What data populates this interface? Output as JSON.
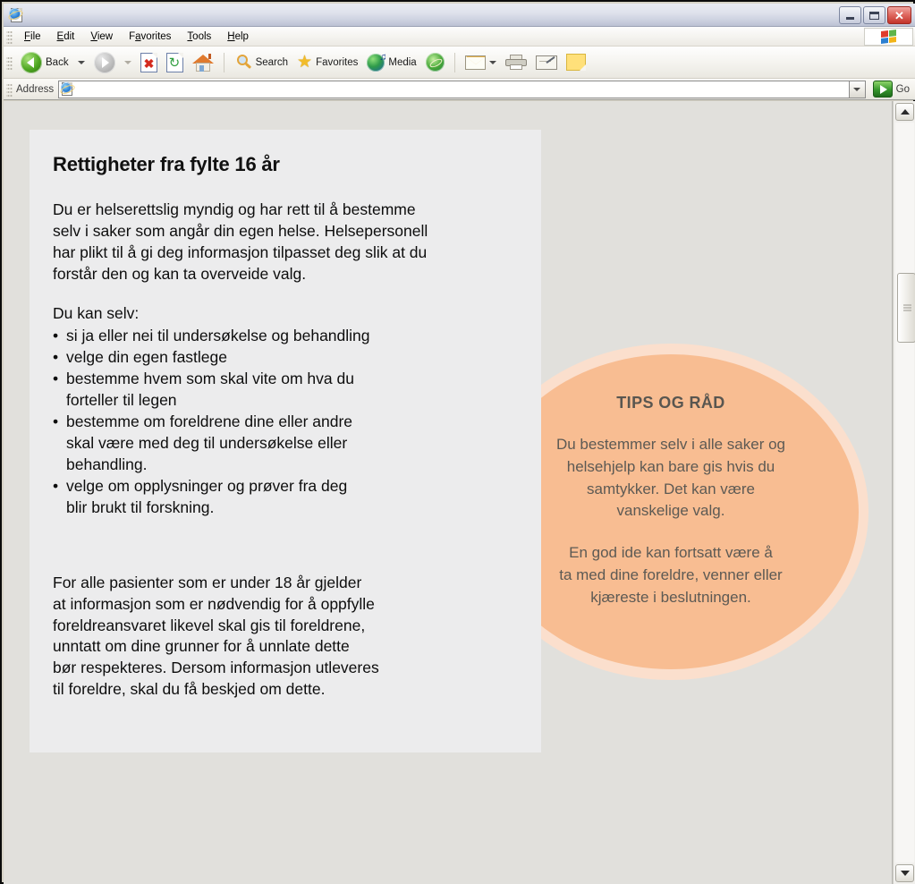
{
  "window": {
    "title": "",
    "app_icon": "ie-logo-icon",
    "buttons": {
      "minimize": "Minimize",
      "maximize": "Maximize",
      "close": "Close"
    }
  },
  "menu": {
    "items": [
      {
        "label": "File",
        "accel": "F"
      },
      {
        "label": "Edit",
        "accel": "E"
      },
      {
        "label": "View",
        "accel": "V"
      },
      {
        "label": "Favorites",
        "accel": "a"
      },
      {
        "label": "Tools",
        "accel": "T"
      },
      {
        "label": "Help",
        "accel": "H"
      }
    ],
    "brand_icon": "windows-flag-icon"
  },
  "toolbar": {
    "back_label": "Back",
    "forward_label": "",
    "stop_label": "",
    "refresh_label": "",
    "home_label": "",
    "search_label": "Search",
    "favorites_label": "Favorites",
    "media_label": "Media",
    "history_label": "",
    "mail_label": "",
    "print_label": "",
    "edit_label": "",
    "notes_label": ""
  },
  "address": {
    "label": "Address",
    "value": "",
    "placeholder": "",
    "go_label": "Go"
  },
  "page": {
    "card": {
      "title": "Rettigheter fra fylte 16 år",
      "intro": "Du er helserettslig myndig og har rett til å bestemme\nselv i saker som angår din egen helse. Helsepersonell\nhar plikt til å gi deg informasjon tilpasset deg slik at du\n forstår den og kan ta overveide valg.",
      "list_lead": "Du kan selv:",
      "bullets": [
        "si ja eller nei til undersøkelse og behandling",
        "velge din egen fastlege",
        "bestemme hvem som skal vite om hva du\nforteller til legen",
        "bestemme om foreldrene dine eller andre\nskal være med deg til undersøkelse eller\nbehandling.",
        "velge om opplysninger og prøver fra deg\nblir brukt til forskning."
      ],
      "outro": "For alle pasienter som er under 18 år gjelder\nat informasjon som er nødvendig for å oppfylle\nforeldreansvaret likevel skal gis til foreldrene,\nunntatt om dine grunner for å unnlate dette\nbør respekteres. Dersom informasjon utleveres\ntil foreldre, skal du få beskjed om dette."
    },
    "tips": {
      "title": "TIPS OG RÅD",
      "paragraph1": "Du bestemmer selv i alle saker og\nhelsehjelp kan bare gis hvis du\nsamtykker. Det kan være\nvanskelige valg.",
      "paragraph2": "En god ide kan fortsatt være å\nta med dine foreldre, venner eller\nkjæreste i beslutningen."
    }
  },
  "colors": {
    "tips_fill": "#f8bd92",
    "tips_halo": "#fbdfcd",
    "tips_text": "#5d5a54",
    "card_bg": "#ececed",
    "page_bg": "#e1e0dc",
    "go_green": "#36962c"
  }
}
